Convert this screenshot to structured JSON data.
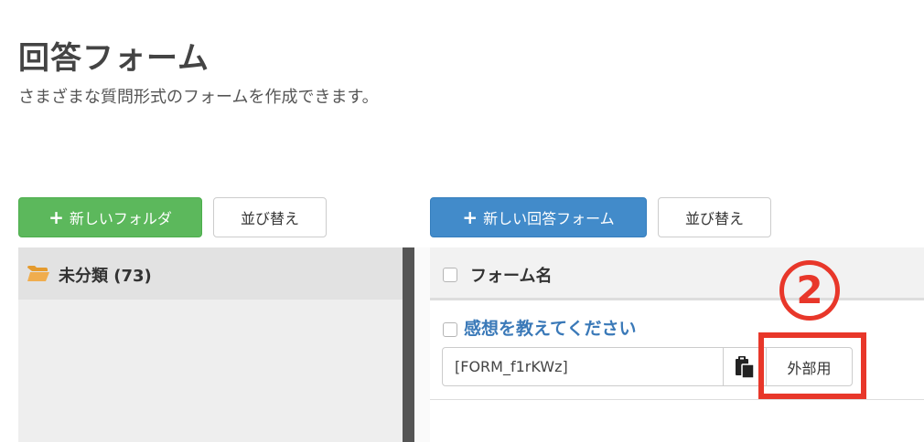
{
  "header": {
    "title": "回答フォーム",
    "subtitle": "さまざまな質問形式のフォームを作成できます。"
  },
  "toolbar": {
    "new_folder_label": "新しいフォルダ",
    "sort_folders_label": "並び替え",
    "new_form_label": "新しい回答フォーム",
    "sort_forms_label": "並び替え"
  },
  "sidebar": {
    "folder_label": "未分類 (73)",
    "folder_icon": "folder-open-icon"
  },
  "form_list": {
    "header_label": "フォーム名",
    "items": [
      {
        "title": "感想を教えてください",
        "code": "[FORM_f1rKWz]",
        "copy_icon": "clipboard-icon",
        "external_label": "外部用"
      }
    ]
  },
  "annotation": {
    "step_marker": "2",
    "color": "#e8372a"
  },
  "colors": {
    "green_button": "#5cb85c",
    "blue_button": "#428bca",
    "link_blue": "#3a79b8",
    "folder_orange": "#f0ad4e"
  }
}
